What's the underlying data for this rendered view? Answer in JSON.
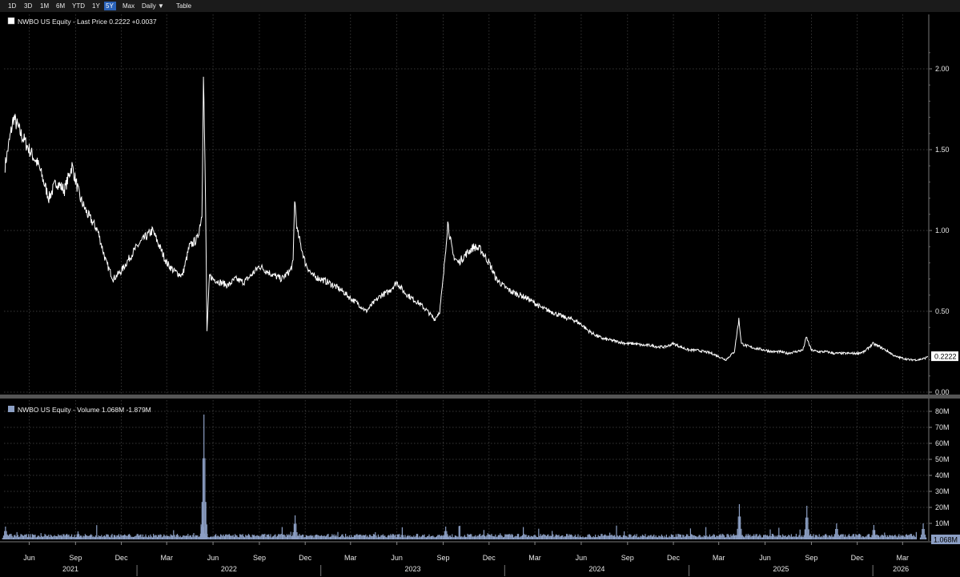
{
  "toolbar": {
    "buttons": [
      {
        "label": "1D",
        "active": false
      },
      {
        "label": "3D",
        "active": false
      },
      {
        "label": "1M",
        "active": false
      },
      {
        "label": "6M",
        "active": false
      },
      {
        "label": "YTD",
        "active": false
      },
      {
        "label": "1Y",
        "active": false
      },
      {
        "label": "5Y",
        "active": true
      },
      {
        "label": "Max",
        "active": false
      },
      {
        "label": "Daily ▼",
        "active": false
      },
      {
        "label": "Table",
        "active": false
      }
    ]
  },
  "colors": {
    "background": "#000000",
    "grid": "#4a4a4a",
    "price_line": "#ffffff",
    "volume_fill": "#8c9fc4",
    "active_button": "#2a62b8"
  },
  "chart_data": [
    {
      "type": "line",
      "legend": "NWBO US Equity - Last Price 0.2222  +0.0037",
      "last_value_label": "0.2222",
      "y_ticks": [
        "0.00",
        "0.50",
        "1.00",
        "1.50",
        "2.00"
      ],
      "ylim": [
        0,
        2.24
      ],
      "grid": true,
      "x_ticks": [
        "Jun",
        "Sep",
        "Dec",
        "Mar",
        "Jun",
        "Sep",
        "Dec",
        "Mar",
        "Jun",
        "Sep",
        "Dec",
        "Mar",
        "Jun",
        "Sep",
        "Dec",
        "Mar",
        "Jun",
        "Sep",
        "Dec",
        "Mar",
        "Jun",
        "Sep",
        "Dec",
        "Mar"
      ],
      "years": [
        "2021",
        "2022",
        "2023",
        "2024",
        "2025",
        "2026"
      ],
      "series": [
        {
          "name": "Last Price",
          "x": [
            "2021-04-14",
            "2021-05-01",
            "2021-05-15",
            "2021-06-01",
            "2021-06-20",
            "2021-07-10",
            "2021-07-25",
            "2021-08-10",
            "2021-08-25",
            "2021-09-10",
            "2021-09-25",
            "2021-10-15",
            "2021-11-01",
            "2021-11-15",
            "2021-12-01",
            "2021-12-15",
            "2022-01-01",
            "2022-01-15",
            "2022-02-01",
            "2022-02-15",
            "2022-03-01",
            "2022-03-15",
            "2022-04-01",
            "2022-04-15",
            "2022-05-01",
            "2022-05-10",
            "2022-05-13",
            "2022-05-17",
            "2022-05-20",
            "2022-05-25",
            "2022-06-01",
            "2022-06-15",
            "2022-07-01",
            "2022-07-15",
            "2022-08-01",
            "2022-08-15",
            "2022-09-01",
            "2022-09-15",
            "2022-10-01",
            "2022-10-15",
            "2022-11-01",
            "2022-11-07",
            "2022-11-10",
            "2022-11-15",
            "2022-12-01",
            "2022-12-15",
            "2023-01-01",
            "2023-01-15",
            "2023-02-01",
            "2023-02-15",
            "2023-03-01",
            "2023-03-15",
            "2023-04-01",
            "2023-04-15",
            "2023-05-01",
            "2023-05-15",
            "2023-06-01",
            "2023-06-15",
            "2023-07-01",
            "2023-07-15",
            "2023-08-01",
            "2023-08-15",
            "2023-08-25",
            "2023-09-01",
            "2023-09-10",
            "2023-09-20",
            "2023-10-01",
            "2023-10-15",
            "2023-11-01",
            "2023-11-15",
            "2023-12-01",
            "2023-12-15",
            "2024-01-01",
            "2024-01-15",
            "2024-02-01",
            "2024-02-15",
            "2024-03-01",
            "2024-03-15",
            "2024-04-01",
            "2024-04-15",
            "2024-05-01",
            "2024-05-15",
            "2024-06-01",
            "2024-06-15",
            "2024-07-01",
            "2024-07-15",
            "2024-08-01",
            "2024-08-15",
            "2024-09-01",
            "2024-09-15",
            "2024-10-01",
            "2024-10-15",
            "2024-11-01",
            "2024-11-15",
            "2024-12-01",
            "2024-12-15",
            "2025-01-01",
            "2025-01-15",
            "2025-02-01",
            "2025-02-15",
            "2025-03-01",
            "2025-03-15",
            "2025-04-01",
            "2025-04-10",
            "2025-04-15",
            "2025-05-01",
            "2025-05-15",
            "2025-06-01",
            "2025-06-15",
            "2025-07-01",
            "2025-07-15",
            "2025-08-01",
            "2025-08-15",
            "2025-08-22",
            "2025-09-01",
            "2025-09-15",
            "2025-10-01",
            "2025-10-15",
            "2025-11-01",
            "2025-11-15",
            "2025-12-01",
            "2025-12-15",
            "2026-01-01",
            "2026-01-15",
            "2026-02-01",
            "2026-02-15",
            "2026-03-01",
            "2026-03-15",
            "2026-04-01",
            "2026-04-15",
            "2026-04-20"
          ],
          "values": [
            1.4,
            1.7,
            1.6,
            1.5,
            1.4,
            1.2,
            1.3,
            1.25,
            1.4,
            1.2,
            1.1,
            1.0,
            0.8,
            0.7,
            0.75,
            0.82,
            0.9,
            0.95,
            1.0,
            0.9,
            0.8,
            0.75,
            0.72,
            0.9,
            0.95,
            1.1,
            2.0,
            1.2,
            0.38,
            0.72,
            0.7,
            0.68,
            0.66,
            0.7,
            0.68,
            0.72,
            0.78,
            0.75,
            0.72,
            0.7,
            0.75,
            0.8,
            1.2,
            1.0,
            0.8,
            0.72,
            0.7,
            0.68,
            0.65,
            0.62,
            0.58,
            0.55,
            0.5,
            0.55,
            0.6,
            0.62,
            0.68,
            0.62,
            0.58,
            0.55,
            0.5,
            0.45,
            0.5,
            0.7,
            1.05,
            0.85,
            0.8,
            0.85,
            0.9,
            0.88,
            0.8,
            0.7,
            0.65,
            0.62,
            0.6,
            0.58,
            0.55,
            0.52,
            0.5,
            0.48,
            0.46,
            0.45,
            0.42,
            0.38,
            0.35,
            0.33,
            0.32,
            0.31,
            0.3,
            0.3,
            0.29,
            0.29,
            0.28,
            0.28,
            0.3,
            0.28,
            0.26,
            0.26,
            0.25,
            0.24,
            0.22,
            0.2,
            0.25,
            0.45,
            0.3,
            0.28,
            0.27,
            0.26,
            0.25,
            0.25,
            0.24,
            0.25,
            0.26,
            0.34,
            0.26,
            0.25,
            0.25,
            0.24,
            0.24,
            0.24,
            0.24,
            0.25,
            0.3,
            0.28,
            0.25,
            0.22,
            0.21,
            0.2,
            0.2,
            0.21,
            0.2222
          ]
        }
      ]
    },
    {
      "type": "bar",
      "legend": "NWBO US Equity - Volume 1.068M  -1.879M",
      "last_value_label": "1.068M",
      "y_ticks": [
        "10M",
        "20M",
        "30M",
        "40M",
        "50M",
        "60M",
        "70M",
        "80M"
      ],
      "ylim": [
        0,
        85
      ],
      "unit": "M",
      "grid": true,
      "spikes": [
        {
          "x": "2021-04-14",
          "value": 8
        },
        {
          "x": "2021-09-05",
          "value": 5
        },
        {
          "x": "2022-05-13",
          "value": 78
        },
        {
          "x": "2022-05-10",
          "value": 12
        },
        {
          "x": "2022-11-10",
          "value": 15
        },
        {
          "x": "2023-09-05",
          "value": 8
        },
        {
          "x": "2025-04-10",
          "value": 22
        },
        {
          "x": "2025-08-22",
          "value": 21
        },
        {
          "x": "2025-10-20",
          "value": 10
        },
        {
          "x": "2026-01-02",
          "value": 9
        },
        {
          "x": "2026-04-10",
          "value": 10
        }
      ],
      "baseline": 2.5
    }
  ]
}
